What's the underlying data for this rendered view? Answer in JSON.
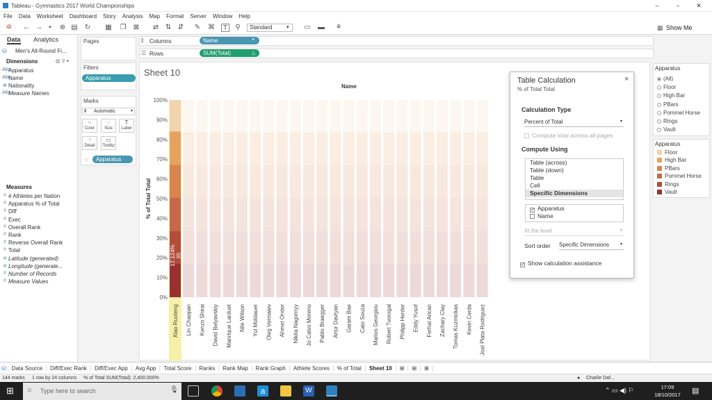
{
  "window": {
    "title": "Tableau - Gymnastics 2017 World Championships"
  },
  "menu": [
    "File",
    "Data",
    "Worksheet",
    "Dashboard",
    "Story",
    "Analysis",
    "Map",
    "Format",
    "Server",
    "Window",
    "Help"
  ],
  "toolbar": {
    "fit": "Standard",
    "show_me": "Show Me"
  },
  "data_pane": {
    "tab_data": "Data",
    "tab_analytics": "Analytics",
    "source": "Men's All-Round Fi...",
    "dimensions_label": "Dimensions",
    "dimensions": [
      "Apparatus",
      "Name",
      "Nationality",
      "Measure Names"
    ],
    "measures_label": "Measures",
    "measures": [
      "# Athletes per Nation",
      "Apparatus % of Total",
      "Diff",
      "Exec",
      "Overall Rank",
      "Rank",
      "Reverse Overall Rank",
      "Total",
      "Latitude (generated)",
      "Longitude (generate...",
      "Number of Records",
      "Measure Values"
    ]
  },
  "shelves": {
    "pages": "Pages",
    "filters": "Filters",
    "filter_pill": "Apparatus",
    "marks": "Marks",
    "marks_type": "Automatic",
    "mark_buttons": [
      "Color",
      "Size",
      "Label",
      "Detail",
      "Tooltip"
    ],
    "marks_pill": "Apparatus",
    "columns": "Columns",
    "columns_pill": "Name",
    "rows": "Rows",
    "rows_pill": "SUM(Total)"
  },
  "sheet": {
    "title": "Sheet 10",
    "col_header": "Name"
  },
  "chart_data": {
    "type": "bar",
    "ylabel": "% of Total Total",
    "ylim": [
      0,
      100
    ],
    "y_ticks": [
      "0%",
      "10%",
      "20%",
      "30%",
      "40%",
      "50%",
      "60%",
      "70%",
      "80%",
      "90%",
      "100%"
    ],
    "categories": [
      "Xiao Ruoteng",
      "Lin Chaopan",
      "Kenzo Shirai",
      "David Belyavskiy",
      "Manrique Larduet",
      "Nile Wilson",
      "Yul Moldauer",
      "Oleg Verniaiev",
      "Ahmet Onder",
      "Nikita Nagornyy",
      "Jo Calvo Moreno",
      "Pablo Braegger",
      "Artur Davtyan",
      "Garam Bae",
      "Caio Souza",
      "Marios Georgiou",
      "Robert Tvorogal",
      "Philipp Herder",
      "Eddy Yusof",
      "Ferhat Arican",
      "Zachary Clay",
      "Tomas Kuzmickas",
      "Kevin Cerda",
      "Joel Plata Rodriguez"
    ],
    "series": [
      {
        "name": "Vault",
        "values": [
          17.1,
          17.0,
          17.2,
          16.9,
          17.0,
          16.8,
          17.0,
          16.9,
          17.1,
          16.8,
          17.0,
          16.9,
          17.0,
          16.8,
          17.1,
          16.9,
          17.0,
          16.8,
          16.9,
          17.0,
          16.8,
          17.0,
          16.9,
          17.1
        ]
      },
      {
        "name": "Rings",
        "values": [
          16.6,
          16.7,
          16.5,
          16.8,
          16.6,
          16.7,
          16.6,
          16.8,
          16.5,
          16.7,
          16.6,
          16.8,
          16.5,
          16.7,
          16.6,
          16.8,
          16.5,
          16.7,
          16.6,
          16.8,
          16.7,
          16.5,
          16.8,
          16.6
        ]
      },
      {
        "name": "Pommel Horse",
        "values": [
          16.8,
          16.6,
          16.7,
          16.5,
          16.8,
          16.7,
          16.6,
          16.6,
          16.8,
          16.7,
          16.5,
          16.6,
          16.8,
          16.7,
          16.6,
          16.5,
          16.8,
          16.7,
          16.6,
          16.5,
          16.7,
          16.8,
          16.6,
          16.6
        ]
      },
      {
        "name": "PBars",
        "values": [
          16.7,
          16.8,
          16.6,
          16.7,
          16.5,
          16.8,
          16.7,
          16.6,
          16.7,
          16.6,
          16.8,
          16.7,
          16.6,
          16.8,
          16.7,
          16.6,
          16.7,
          16.8,
          16.6,
          16.7,
          16.6,
          16.7,
          16.6,
          16.5
        ]
      },
      {
        "name": "High Bar",
        "values": [
          16.9,
          16.5,
          16.8,
          16.7,
          16.7,
          16.5,
          16.8,
          16.7,
          16.6,
          16.9,
          16.7,
          16.5,
          16.7,
          16.6,
          16.5,
          16.8,
          16.6,
          16.5,
          16.8,
          16.6,
          16.8,
          16.6,
          16.7,
          16.8
        ]
      },
      {
        "name": "Floor",
        "values": [
          15.9,
          16.4,
          16.2,
          16.4,
          16.4,
          16.5,
          16.3,
          16.4,
          16.3,
          16.3,
          16.4,
          16.5,
          16.4,
          16.4,
          16.5,
          16.4,
          16.4,
          16.5,
          16.5,
          16.4,
          16.4,
          16.4,
          16.4,
          16.4
        ]
      }
    ],
    "colors": {
      "Floor": "#f2d3b0",
      "High Bar": "#e6a25f",
      "PBars": "#d9834f",
      "Pommel Horse": "#c8684a",
      "Rings": "#b44c3c",
      "Vault": "#9a2f2f"
    },
    "highlight_category": "Xiao Ruoteng",
    "highlight_color": "#f7f0a8",
    "label_first": "17.124%",
    "label_first_sub": "[6]"
  },
  "legend": {
    "filter_title": "Apparatus",
    "filter_items": [
      "(All)",
      "Floor",
      "High Bar",
      "PBars",
      "Pommel Horse",
      "Rings",
      "Vault"
    ],
    "color_title": "Apparatus",
    "color_items": [
      "Floor",
      "High Bar",
      "PBars",
      "Pommel Horse",
      "Rings",
      "Vault"
    ]
  },
  "table_calc": {
    "title": "Table Calculation",
    "subtitle": "% of Total Total",
    "calc_type_label": "Calculation Type",
    "calc_type": "Percent of Total",
    "compute_total": "Compute total across all pages",
    "compute_using_label": "Compute Using",
    "compute_options": [
      "Table (across)",
      "Table (down)",
      "Table",
      "Cell",
      "Specific Dimensions"
    ],
    "dims": [
      {
        "label": "Apparatus",
        "checked": true
      },
      {
        "label": "Name",
        "checked": false
      }
    ],
    "at_level": "At the level",
    "sort_order_label": "Sort order",
    "sort_order": "Specific Dimensions",
    "show_assist": "Show calculation assistance",
    "close": "×"
  },
  "sheet_tabs": [
    "Data Source",
    "Diff/Exec Rank",
    "Diff/Exec App",
    "Avg App",
    "Total Score",
    "Ranks",
    "Rank Map",
    "Rank Graph",
    "Athlete Scores",
    "% of Total",
    "Sheet 10"
  ],
  "status": {
    "marks": "144 marks",
    "dims": "1 row by 24 columns",
    "sum": "% of Total SUM(Total): 2,400.000%",
    "user": "Charlie Daf..."
  },
  "taskbar": {
    "search": "Type here to search",
    "time": "17:09",
    "date": "18/10/2017"
  }
}
